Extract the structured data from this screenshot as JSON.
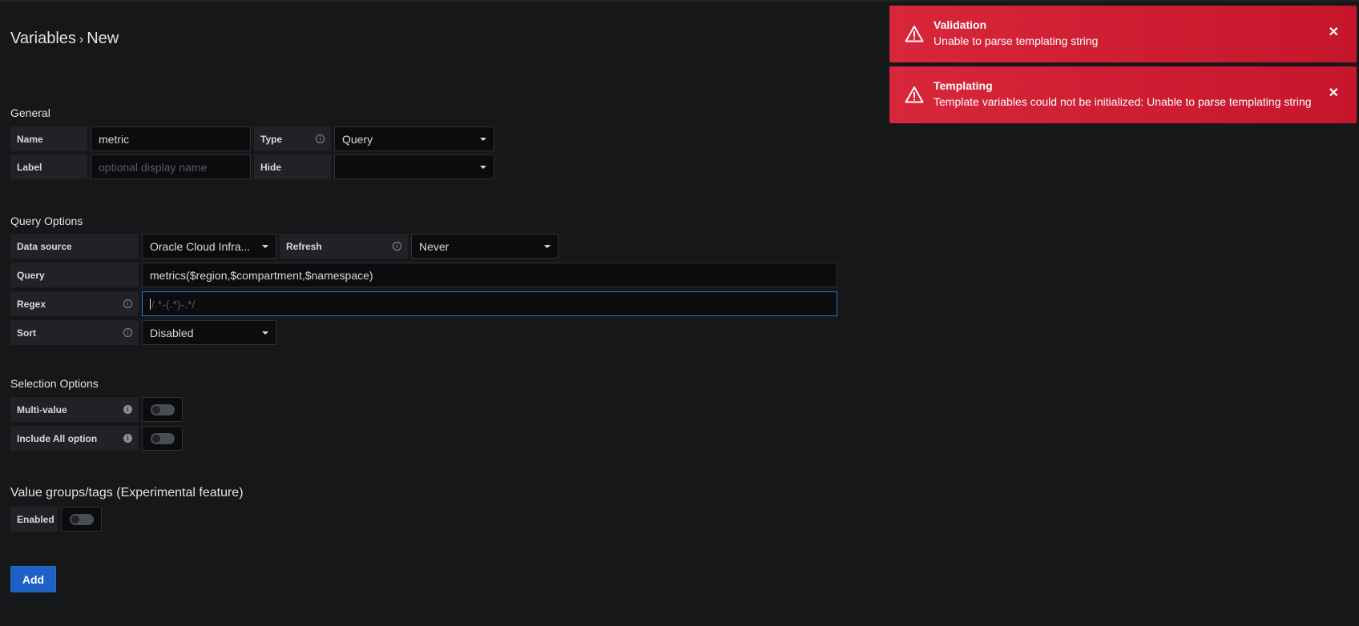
{
  "breadcrumb": {
    "parent": "Variables",
    "separator": "›",
    "current": "New"
  },
  "general": {
    "heading": "General",
    "name_label": "Name",
    "name_value": "metric",
    "type_label": "Type",
    "type_value": "Query",
    "label_label": "Label",
    "label_placeholder": "optional display name",
    "hide_label": "Hide",
    "hide_value": ""
  },
  "query_options": {
    "heading": "Query Options",
    "datasource_label": "Data source",
    "datasource_value": "Oracle Cloud Infra...",
    "refresh_label": "Refresh",
    "refresh_value": "Never",
    "query_label": "Query",
    "query_value": "metrics($region,$compartment,$namespace)",
    "regex_label": "Regex",
    "regex_placeholder": "/.*-(.*)-.*/",
    "sort_label": "Sort",
    "sort_value": "Disabled"
  },
  "selection_options": {
    "heading": "Selection Options",
    "multi_label": "Multi-value",
    "multi_on": false,
    "include_all_label": "Include All option",
    "include_all_on": false
  },
  "value_groups": {
    "heading": "Value groups/tags (Experimental feature)",
    "enabled_label": "Enabled",
    "enabled_on": false
  },
  "actions": {
    "add_label": "Add"
  },
  "toasts": [
    {
      "title": "Validation",
      "text": "Unable to parse templating string"
    },
    {
      "title": "Templating",
      "text": "Template variables could not be initialized: Unable to parse templating string"
    }
  ],
  "colors": {
    "toast_bg": "#d8263a",
    "primary": "#1f60c4",
    "focus_border": "#3274d9"
  }
}
